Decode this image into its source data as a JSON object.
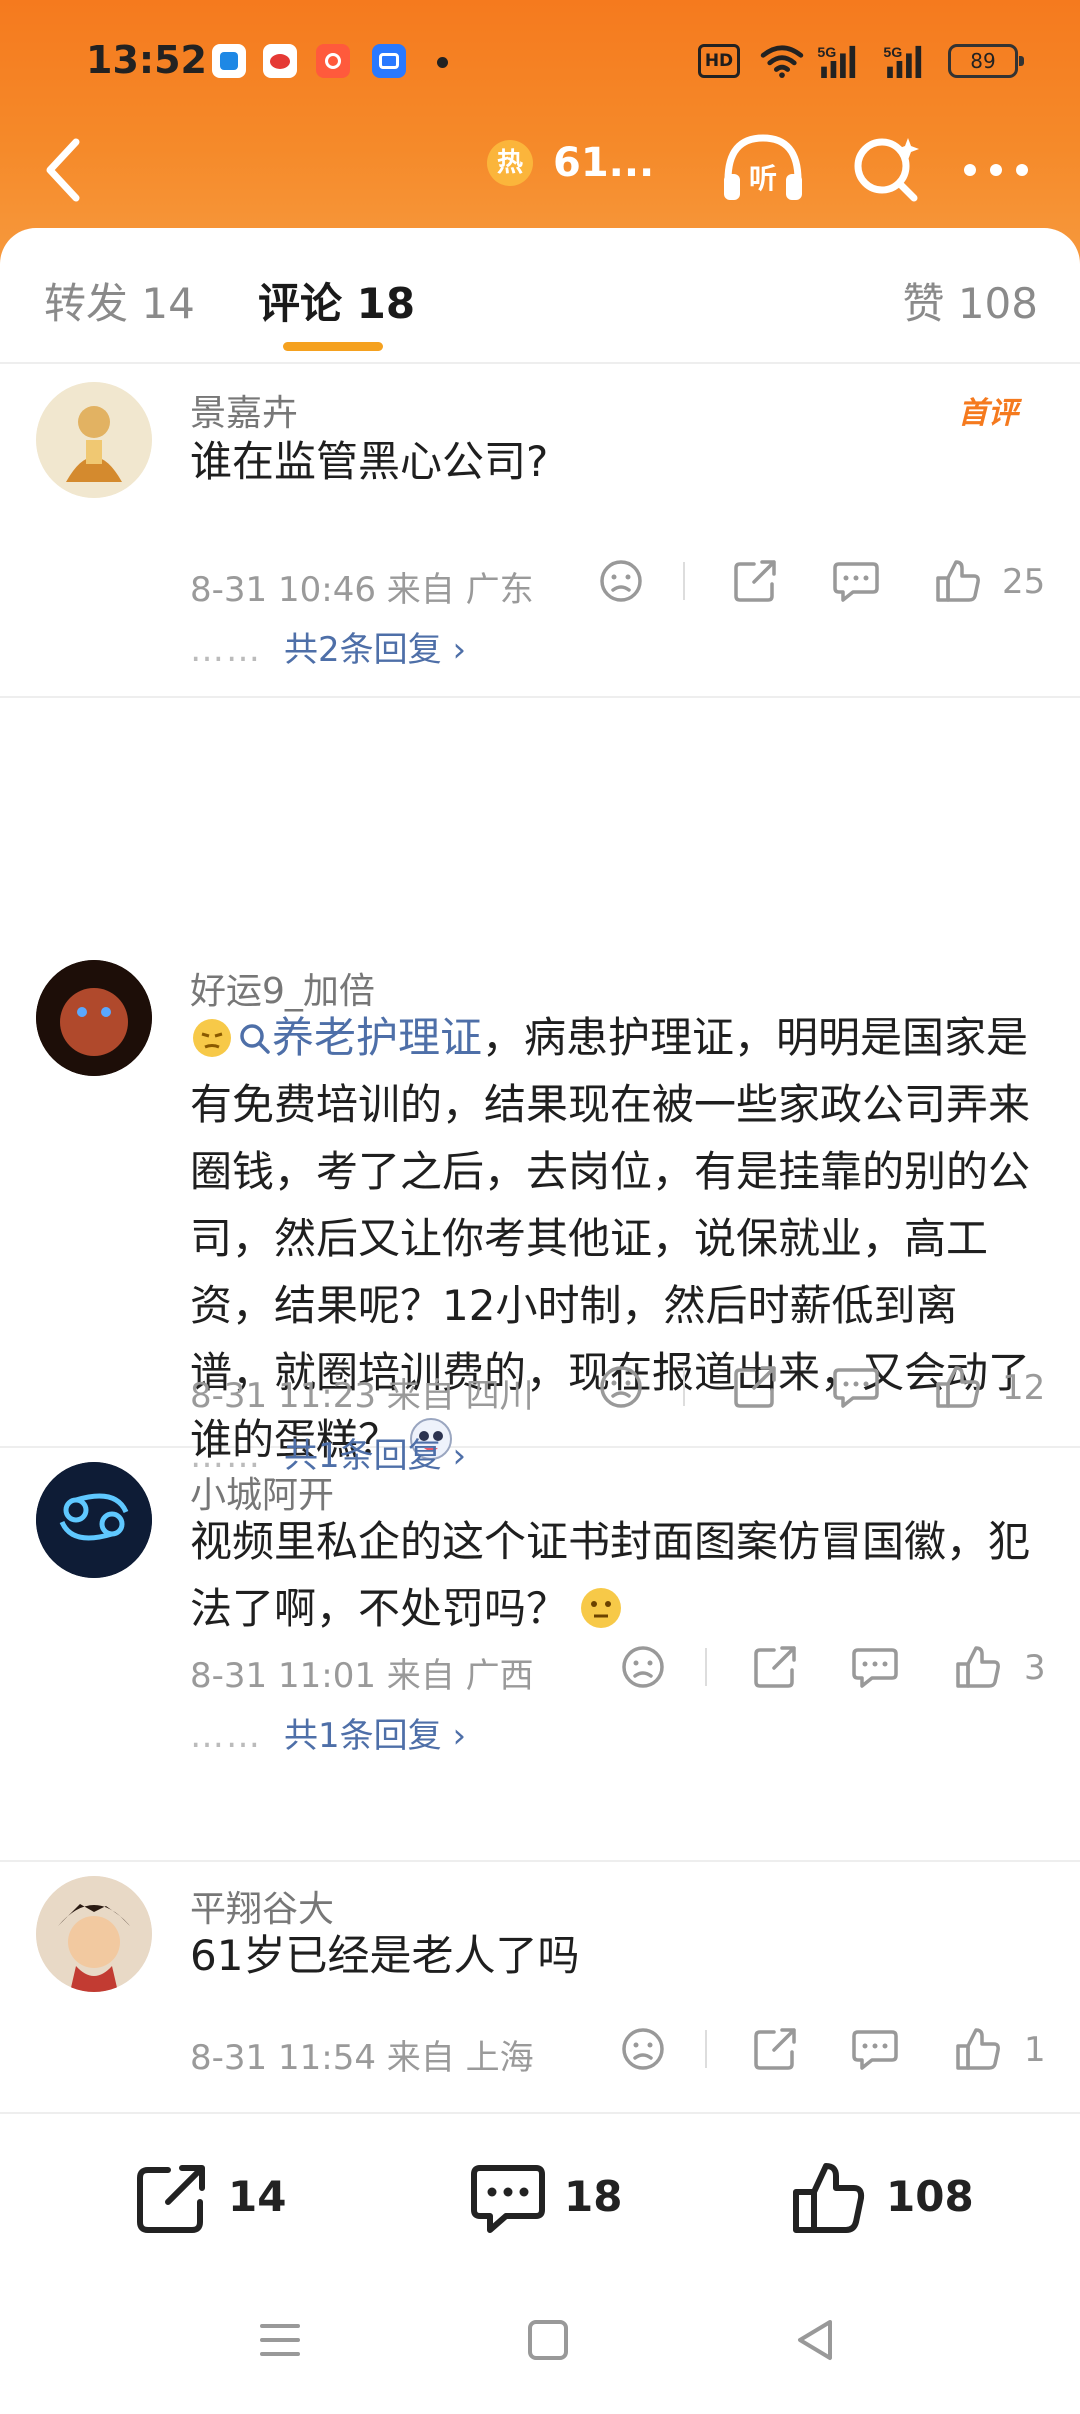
{
  "status_bar": {
    "time": "13:52",
    "network_hd": "HD",
    "battery": "89"
  },
  "nav": {
    "hot_badge": "热",
    "title": "61..."
  },
  "tabs": {
    "repost": "转发 14",
    "comments": "评论 18",
    "likes": "赞 108"
  },
  "comments": [
    {
      "username": "景嘉卉",
      "badge": "首评",
      "text": "谁在监管黑心公司?",
      "meta": "8-31 10:46  来自 广东",
      "likes": "25",
      "replies": "共2条回复 ›"
    },
    {
      "username": "好运9_加倍",
      "topic": "养老护理证",
      "text": "，病患护理证，明明是国家是有免费培训的，结果现在被一些家政公司弄来圈钱，考了之后，去岗位，有是挂靠的别的公司，然后又让你考其他证，说保就业，高工资，结果呢？12小时制，然后时薪低到离谱，就圈培训费的，现在报道出来，又会动了谁的蛋糕？",
      "meta": "8-31 11:23  来自 四川",
      "likes": "12",
      "replies": "共1条回复 ›"
    },
    {
      "username": "小城阿开",
      "text": "视频里私企的这个证书封面图案仿冒国徽，犯法了啊，不处罚吗？",
      "meta": "8-31 11:01  来自 广西",
      "likes": "3",
      "replies": "共1条回复 ›"
    },
    {
      "username": "平翔谷大",
      "text": "61岁已经是老人了吗",
      "meta": "8-31 11:54  来自 上海",
      "likes": "1"
    }
  ],
  "reply_dots": "……",
  "bottom_bar": {
    "reposts": "14",
    "comments": "18",
    "likes": "108"
  },
  "colors": {
    "header": "#f57a1e",
    "link": "#4e6fa8",
    "tab_indicator": "#f5a11f"
  }
}
